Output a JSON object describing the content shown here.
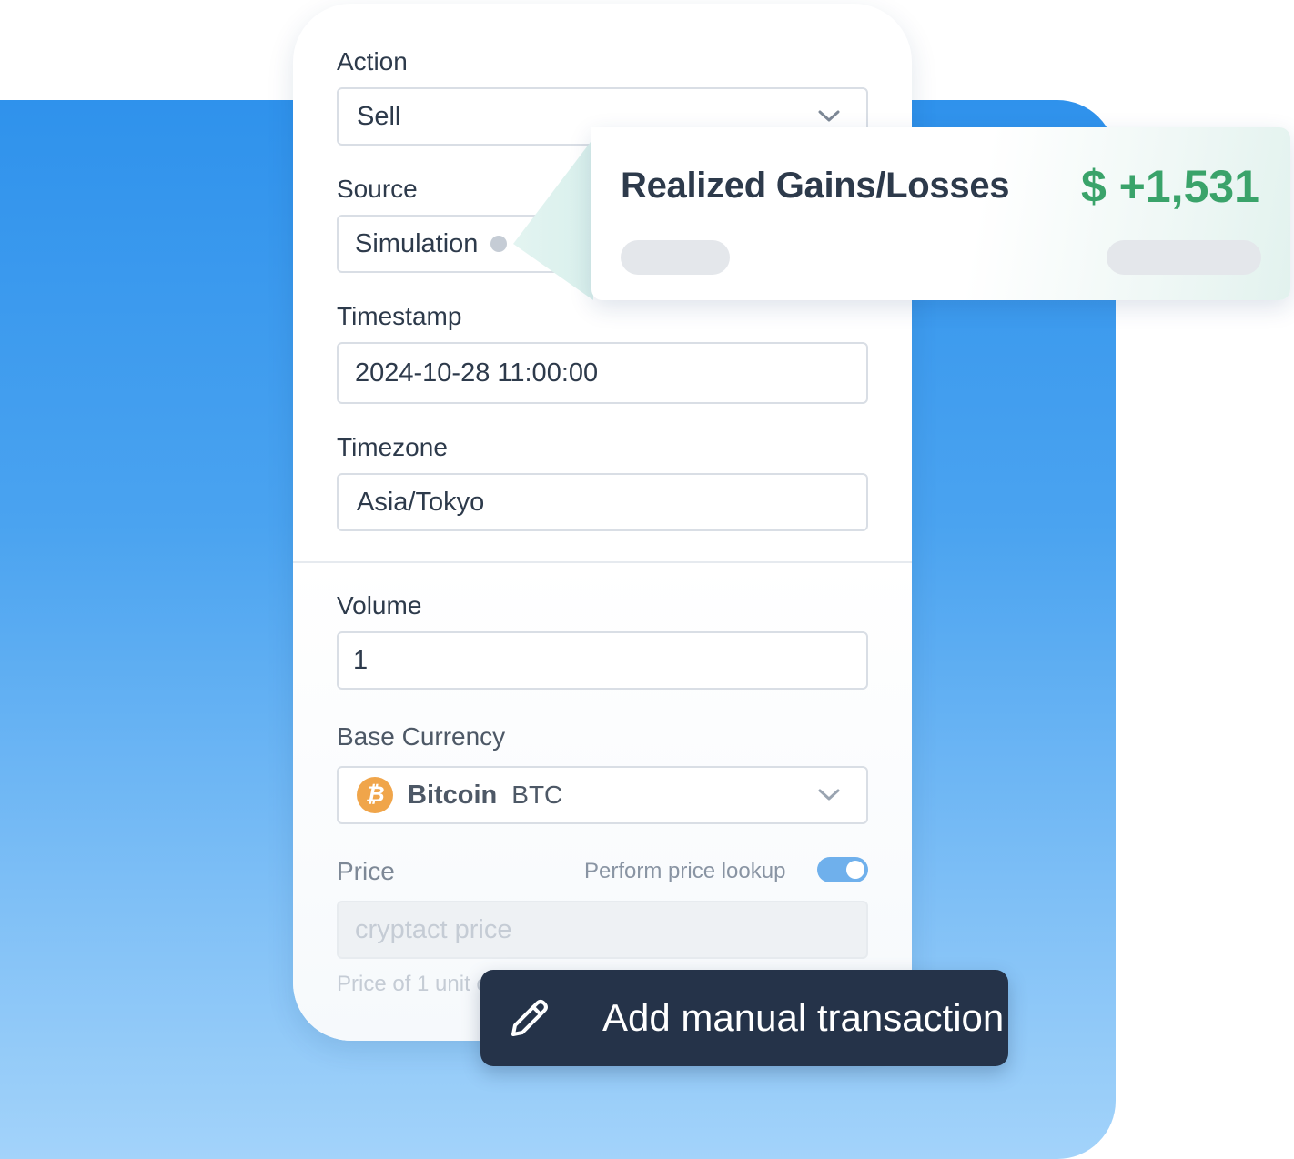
{
  "form": {
    "action": {
      "label": "Action",
      "value": "Sell"
    },
    "source": {
      "label": "Source",
      "value": "Simulation"
    },
    "timestamp": {
      "label": "Timestamp",
      "value": "2024-10-28 11:00:00"
    },
    "timezone": {
      "label": "Timezone",
      "value": "Asia/Tokyo"
    },
    "volume": {
      "label": "Volume",
      "value": "1"
    },
    "base_currency": {
      "label": "Base Currency",
      "coin_name": "Bitcoin",
      "coin_symbol": "BTC",
      "coin_glyph": "₿"
    },
    "price": {
      "label": "Price",
      "lookup_label": "Perform price lookup",
      "lookup_enabled": true,
      "placeholder": "cryptact price"
    },
    "hint": "Price of 1 unit o"
  },
  "gains_card": {
    "title": "Realized Gains/Losses",
    "value": "$ +1,531"
  },
  "cta": {
    "label": "Add manual transaction"
  },
  "colors": {
    "brand_blue": "#2f92ec",
    "gain_green": "#3aa36a",
    "cta_bg": "#253349",
    "btc_orange": "#f0a54a"
  },
  "icons": [
    "chevron-down-icon",
    "bitcoin-icon",
    "pencil-icon"
  ]
}
